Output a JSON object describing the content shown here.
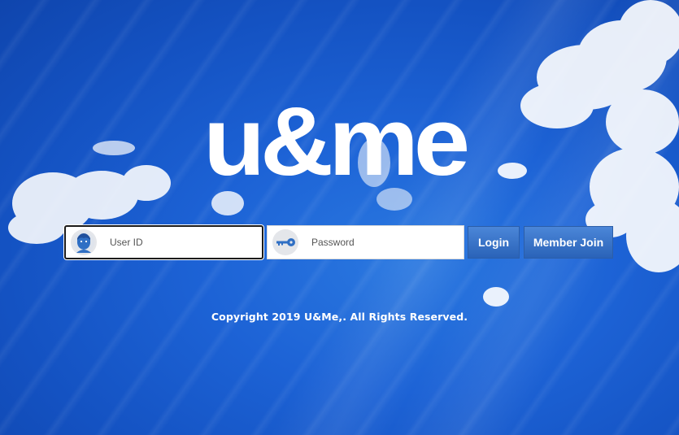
{
  "brand": {
    "logo_text": "u&me"
  },
  "login_form": {
    "user_id_placeholder": "User ID",
    "password_placeholder": "Password",
    "login_label": "Login",
    "member_join_label": "Member Join",
    "user_icon": "user-avatar-icon",
    "password_icon": "key-icon"
  },
  "footer": {
    "copyright": "Copyright 2019 U&Me,. All Rights Reserved."
  },
  "colors": {
    "background": "#1d63d6",
    "button": "#3a73c8",
    "icon_accent": "#2f6fc4"
  }
}
